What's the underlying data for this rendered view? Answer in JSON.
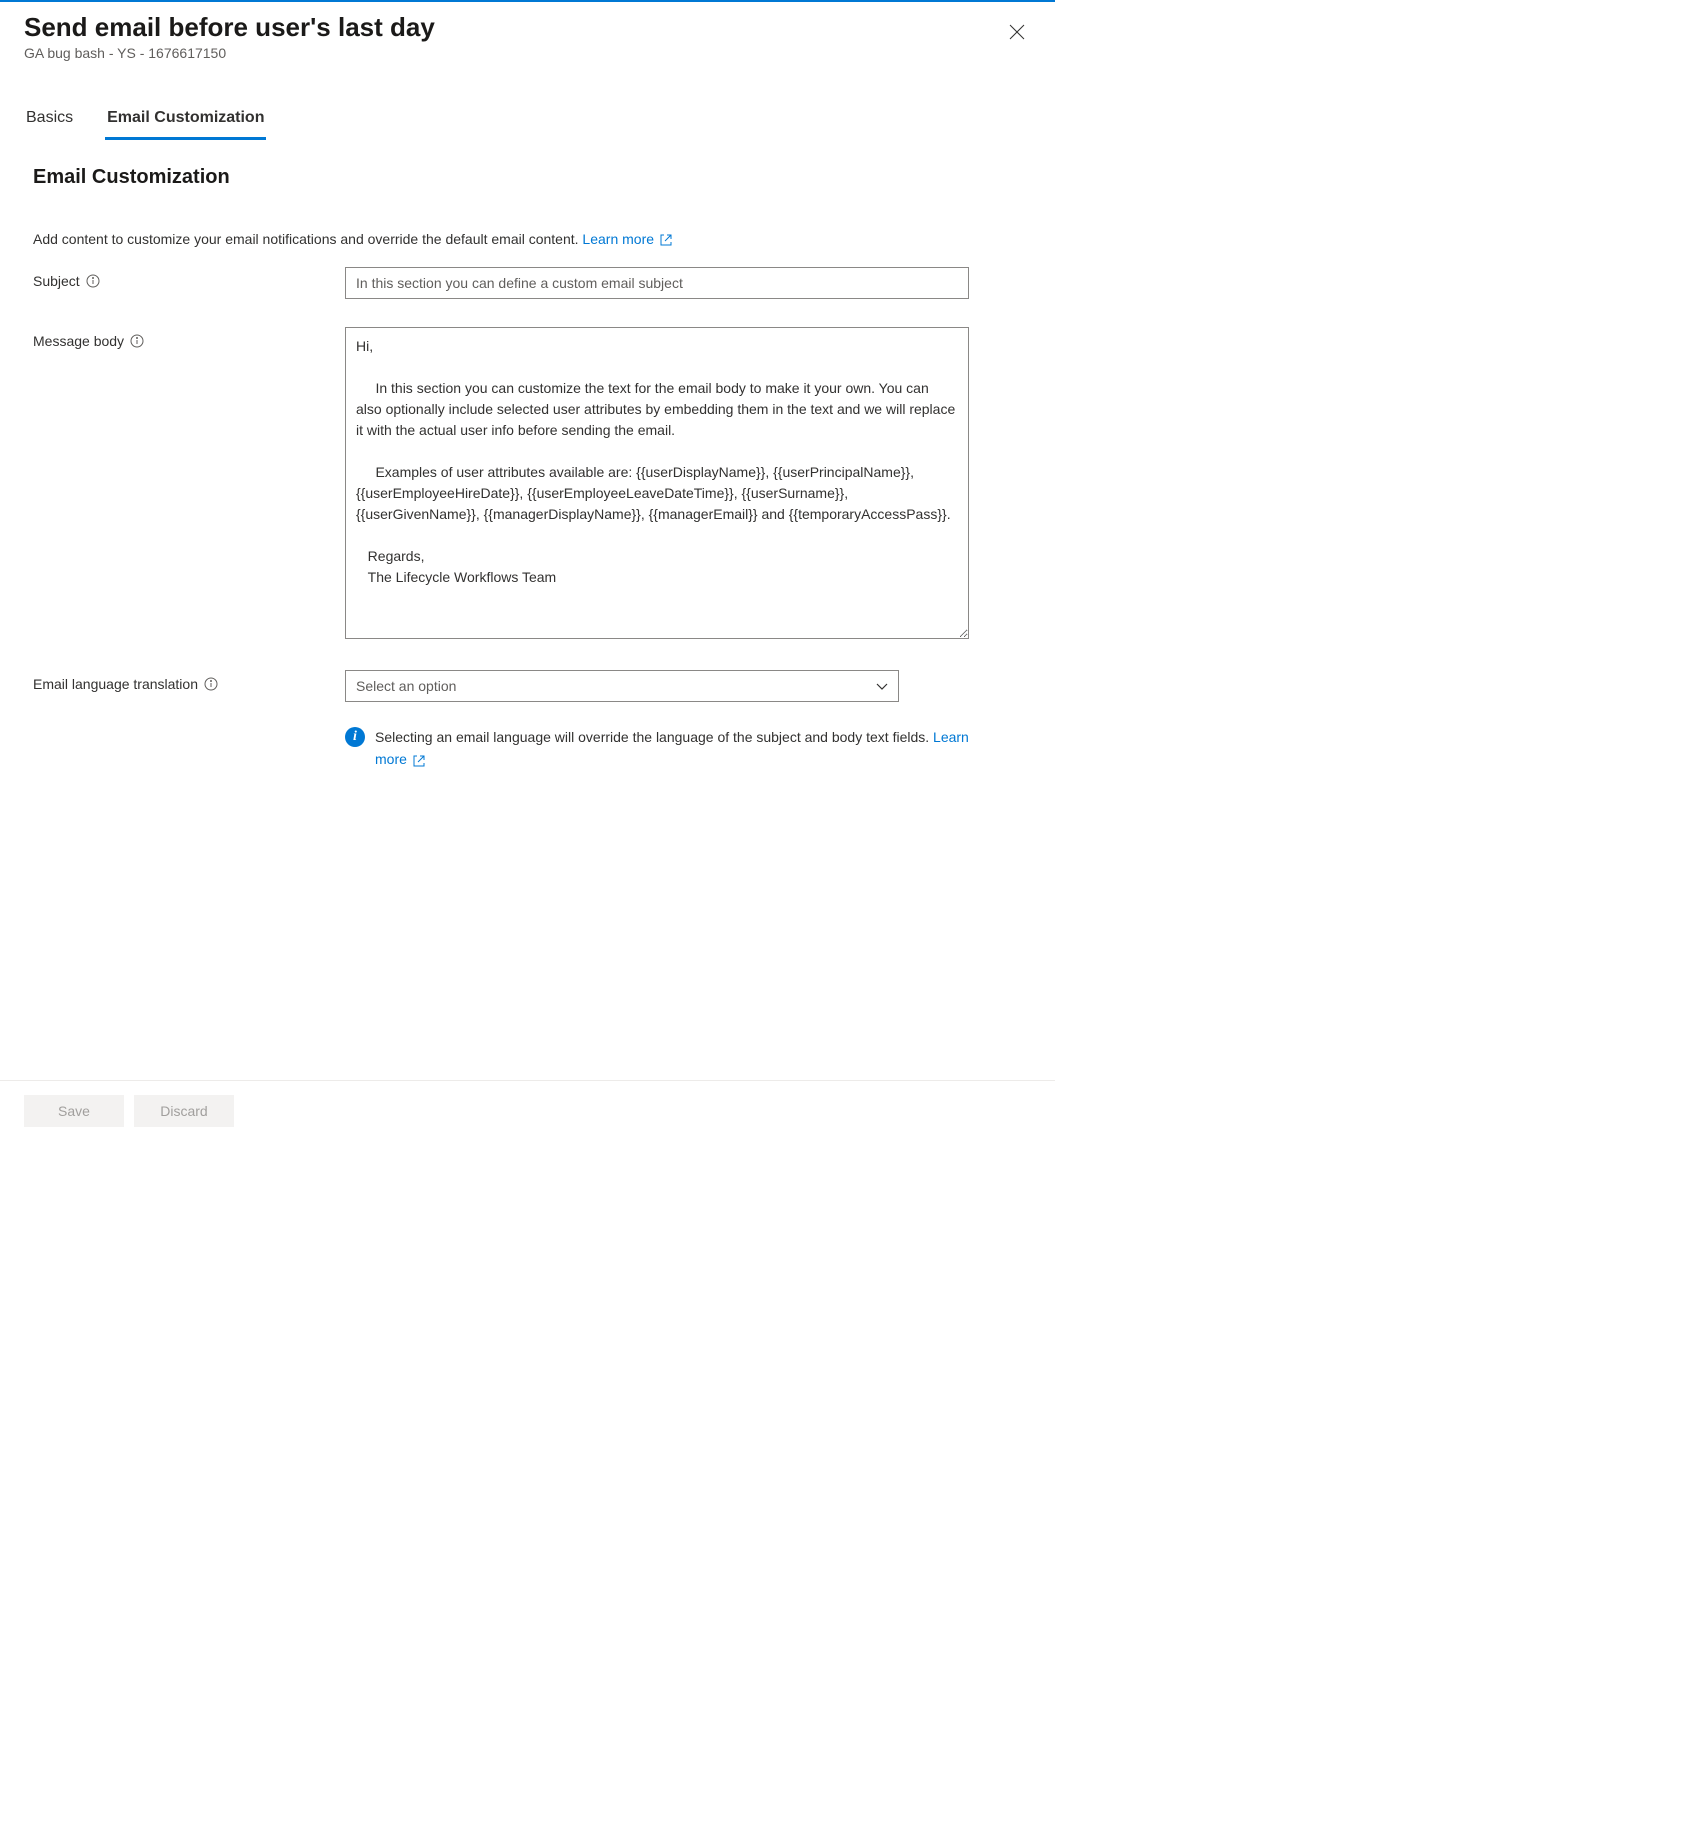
{
  "header": {
    "title": "Send email before user's last day",
    "subtitle": "GA bug bash - YS - 1676617150"
  },
  "tabs": {
    "basics": "Basics",
    "email_customization": "Email Customization"
  },
  "section": {
    "title": "Email Customization",
    "intro": "Add content to customize your email notifications and override the default email content.",
    "learn_more": "Learn more"
  },
  "form": {
    "subject": {
      "label": "Subject",
      "placeholder": "In this section you can define a custom email subject"
    },
    "message_body": {
      "label": "Message body",
      "value": "Hi,\n\n     In this section you can customize the text for the email body to make it your own. You can also optionally include selected user attributes by embedding them in the text and we will replace it with the actual user info before sending the email.\n\n     Examples of user attributes available are: {{userDisplayName}}, {{userPrincipalName}}, {{userEmployeeHireDate}}, {{userEmployeeLeaveDateTime}}, {{userSurname}}, {{userGivenName}}, {{managerDisplayName}}, {{managerEmail}} and {{temporaryAccessPass}}.\n\n   Regards,\n   The Lifecycle Workflows Team"
    },
    "language": {
      "label": "Email language translation",
      "placeholder": "Select an option",
      "info_text": "Selecting an email language will override the language of the subject and body text fields.",
      "learn_more": "Learn more"
    }
  },
  "footer": {
    "save": "Save",
    "discard": "Discard"
  }
}
